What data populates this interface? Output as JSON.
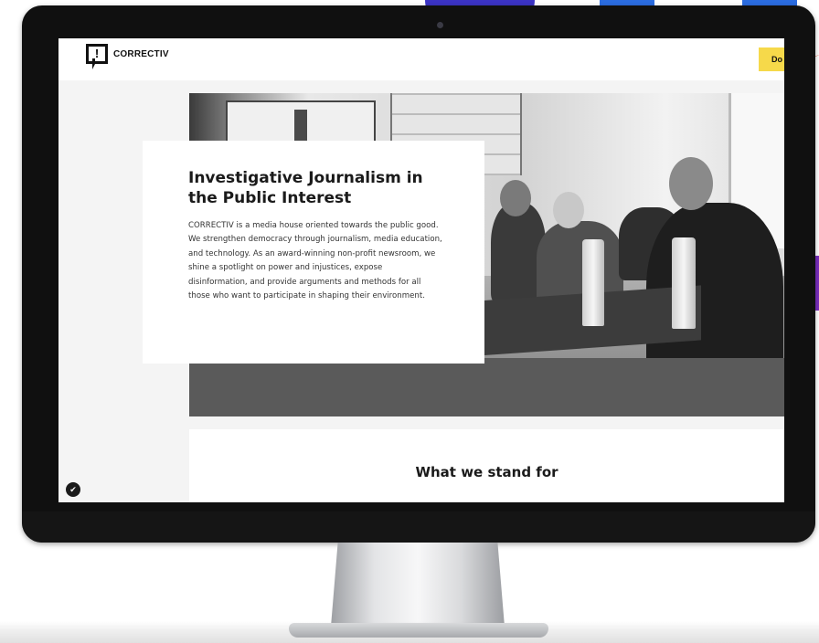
{
  "site": {
    "logo_text": "CORRECTIV",
    "logo_glyph": "!",
    "donate_label": "Do"
  },
  "hero": {
    "title": "Investigative Journalism in the Public Interest",
    "body": "CORRECTIV is a media house oriented towards the public good. We strengthen democracy through journalism, media education, and technology. As an award-winning non-profit newsroom, we shine a spotlight on power and injustices, expose disinformation, and provide arguments and methods for all those who want to participate in shaping their environment."
  },
  "section": {
    "heading": "What we stand for"
  },
  "icons": {
    "privacy": "shield-check-icon",
    "logo": "speech-bubble-exclamation-icon"
  },
  "colors": {
    "donate": "#f6d94a",
    "bezel": "#101010",
    "accent_blue": "#3b33c4",
    "accent_purple": "#7b2fc0"
  }
}
